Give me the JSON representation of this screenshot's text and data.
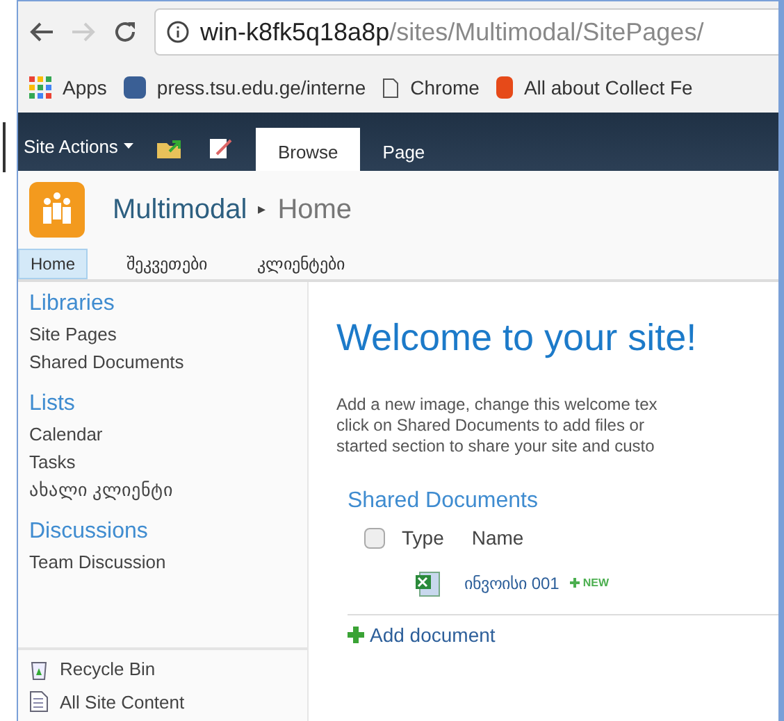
{
  "browser": {
    "url_host": "win-k8fk5q18a8p",
    "url_path": "/sites/Multimodal/SitePages/",
    "bookmarks": [
      {
        "kind": "apps",
        "label": "Apps"
      },
      {
        "kind": "site",
        "label": "press.tsu.edu.ge/interne"
      },
      {
        "kind": "page",
        "label": "Chrome"
      },
      {
        "kind": "office",
        "label": "All about Collect Fe"
      }
    ]
  },
  "ribbon": {
    "site_actions": "Site Actions",
    "tabs": [
      {
        "label": "Browse",
        "selected": true
      },
      {
        "label": "Page",
        "selected": false
      }
    ]
  },
  "site": {
    "title": "Multimodal",
    "separator": "▸",
    "page": "Home"
  },
  "top_nav": [
    {
      "label": "Home",
      "selected": true
    },
    {
      "label": "შეკვეთები",
      "selected": false
    },
    {
      "label": "კლიენტები",
      "selected": false
    }
  ],
  "quick_launch": [
    {
      "heading": "Libraries",
      "items": [
        "Site Pages",
        "Shared Documents"
      ]
    },
    {
      "heading": "Lists",
      "items": [
        "Calendar",
        "Tasks",
        "ახალი კლიენტი"
      ]
    },
    {
      "heading": "Discussions",
      "items": [
        "Team Discussion"
      ]
    }
  ],
  "bottom_links": [
    {
      "kind": "recycle",
      "label": "Recycle Bin"
    },
    {
      "kind": "content",
      "label": "All Site Content"
    }
  ],
  "content": {
    "heading": "Welcome to your site!",
    "intro": [
      "Add a new image, change this welcome tex",
      "click on Shared Documents to add files or",
      "started section to share your site and custo"
    ],
    "library": {
      "title": "Shared Documents",
      "columns": [
        "Type",
        "Name"
      ],
      "select_all": false,
      "rows": [
        {
          "name": "ინვოისი 001",
          "badge": "NEW"
        }
      ],
      "add": "Add document"
    }
  }
}
